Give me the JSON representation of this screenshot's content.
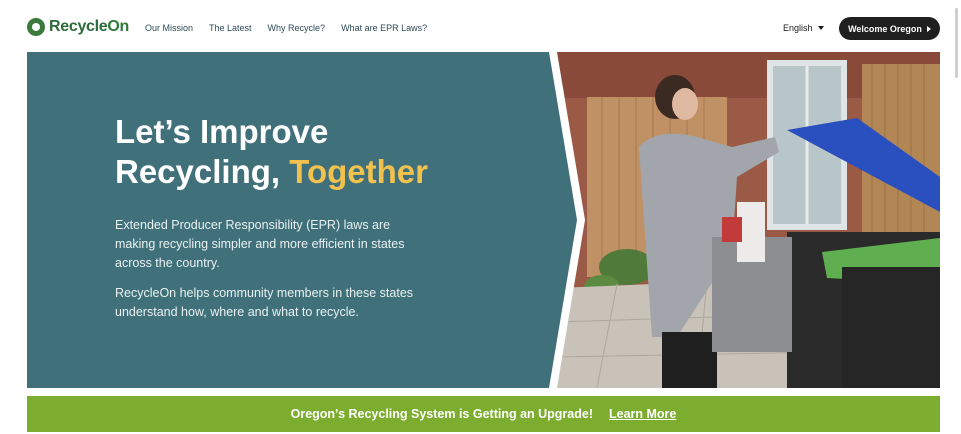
{
  "brand": {
    "name_part1": "Recycle",
    "name_part2": "On"
  },
  "nav": [
    {
      "label": "Our Mission"
    },
    {
      "label": "The Latest"
    },
    {
      "label": "Why Recycle?"
    },
    {
      "label": "What are EPR Laws?"
    }
  ],
  "language": {
    "selected": "English"
  },
  "welcome_button": "Welcome Oregon",
  "hero": {
    "title_line1": "Let’s Improve",
    "title_line2_plain": "Recycling, ",
    "title_line2_accent": "Together",
    "paragraph1": "Extended Producer Responsibility (EPR) laws are making recycling simpler and more efficient in states across the country.",
    "paragraph2": "RecycleOn helps community members in these states understand how, where and what to recycle."
  },
  "banner": {
    "text": "Oregon’s Recycling System is Getting an Upgrade!",
    "link": "Learn More"
  },
  "colors": {
    "hero_panel": "#40707a",
    "accent_yellow": "#f2c14e",
    "banner_green": "#7cad2e",
    "brand_green": "#2c6b3a",
    "button_dark": "#1f1f1f"
  }
}
